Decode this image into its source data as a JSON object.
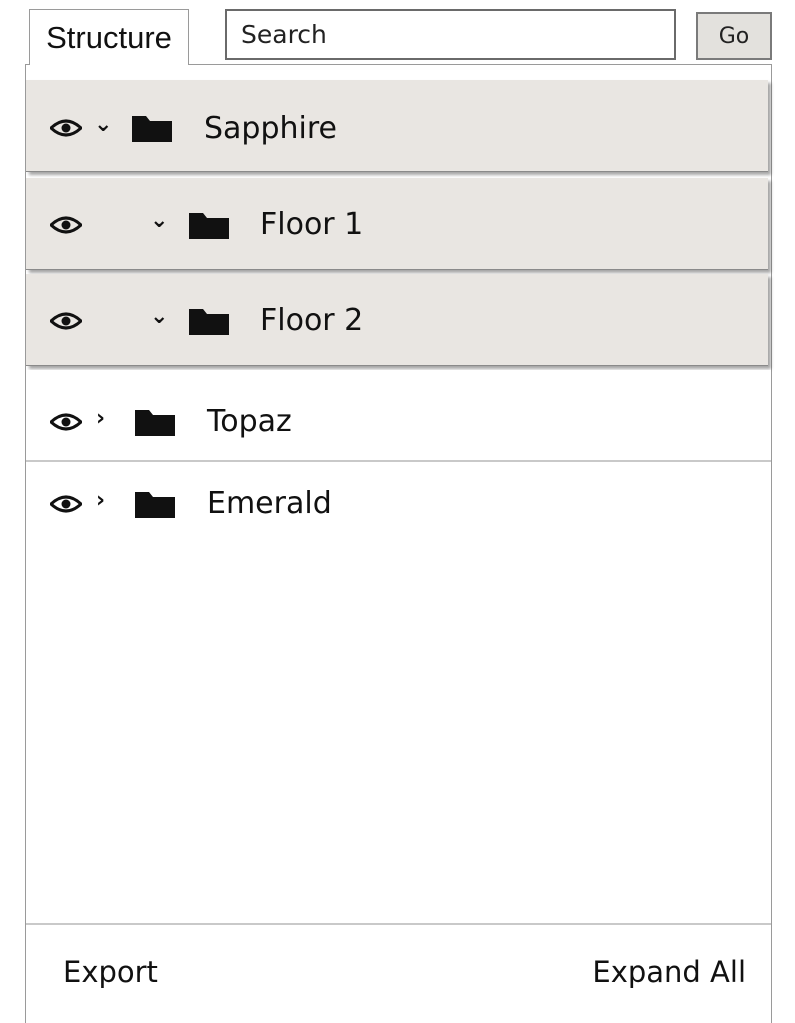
{
  "tab": {
    "label": "Structure"
  },
  "search": {
    "placeholder": "Search"
  },
  "go_button": {
    "label": "Go"
  },
  "tree": {
    "items": [
      {
        "label": "Sapphire",
        "expanded": true,
        "level": 0,
        "selected": true
      },
      {
        "label": "Floor 1",
        "expanded": true,
        "level": 1,
        "selected": true
      },
      {
        "label": "Floor 2",
        "expanded": true,
        "level": 1,
        "selected": true
      },
      {
        "label": "Topaz",
        "expanded": false,
        "level": 0,
        "selected": false
      },
      {
        "label": "Emerald",
        "expanded": false,
        "level": 0,
        "selected": false
      }
    ]
  },
  "footer": {
    "export_label": "Export",
    "expand_all_label": "Expand All"
  },
  "icons": {
    "visibility": "eye-icon",
    "expanded": "chevron-down-icon",
    "collapsed": "chevron-right-icon",
    "node": "folder-icon"
  },
  "colors": {
    "selected_row_bg": "#e9e6e2",
    "go_button_bg": "#e3e1dd",
    "border": "#9a9a9a"
  }
}
